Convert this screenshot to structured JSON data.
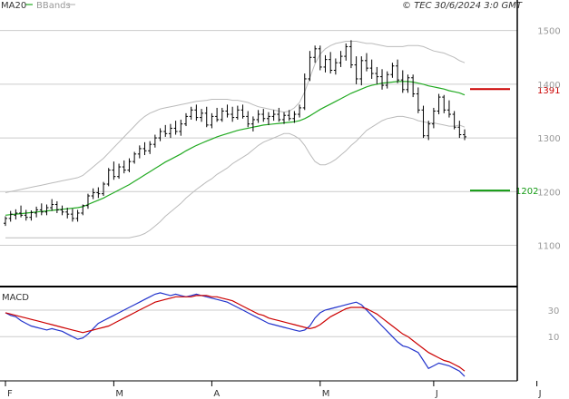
{
  "header": {
    "ma_label": "MA20",
    "bbands_label": "BBands",
    "copyright": "© TEC 30/6/2024 3:0 GMT"
  },
  "colors": {
    "ma": "#22aa22",
    "bbands": "#bbbbbb",
    "resistance": "#cc0000",
    "support": "#119911",
    "macd": "#2233cc",
    "signal": "#cc0000",
    "bars": "#000000",
    "grid": "#cccccc"
  },
  "chart_data": [
    {
      "type": "line",
      "name": "price",
      "ylim": [
        1040,
        1540
      ],
      "yticks": [
        1100,
        1200,
        1300,
        1400,
        1500
      ],
      "ytick_labels": [
        "1100",
        "1200",
        "1300",
        "1400",
        "1500"
      ],
      "month_labels": [
        {
          "label": "F",
          "index": 0
        },
        {
          "label": "M",
          "index": 21
        },
        {
          "label": "A",
          "index": 40
        },
        {
          "label": "M",
          "index": 61
        },
        {
          "label": "J",
          "index": 83
        },
        {
          "label": "J",
          "index": 103
        }
      ],
      "ohlc": [
        [
          1141,
          1154,
          1136,
          1150
        ],
        [
          1150,
          1164,
          1144,
          1158
        ],
        [
          1156,
          1167,
          1148,
          1160
        ],
        [
          1160,
          1174,
          1152,
          1156
        ],
        [
          1156,
          1166,
          1146,
          1152
        ],
        [
          1152,
          1165,
          1146,
          1161
        ],
        [
          1160,
          1172,
          1152,
          1166
        ],
        [
          1166,
          1178,
          1156,
          1162
        ],
        [
          1162,
          1176,
          1156,
          1170
        ],
        [
          1170,
          1186,
          1164,
          1176
        ],
        [
          1176,
          1182,
          1160,
          1166
        ],
        [
          1166,
          1174,
          1156,
          1162
        ],
        [
          1162,
          1170,
          1150,
          1158
        ],
        [
          1158,
          1168,
          1144,
          1150
        ],
        [
          1150,
          1166,
          1144,
          1160
        ],
        [
          1160,
          1176,
          1156,
          1174
        ],
        [
          1174,
          1196,
          1168,
          1192
        ],
        [
          1192,
          1206,
          1186,
          1198
        ],
        [
          1198,
          1208,
          1188,
          1196
        ],
        [
          1196,
          1218,
          1192,
          1214
        ],
        [
          1214,
          1244,
          1210,
          1240
        ],
        [
          1240,
          1256,
          1222,
          1228
        ],
        [
          1228,
          1252,
          1224,
          1246
        ],
        [
          1246,
          1258,
          1234,
          1240
        ],
        [
          1240,
          1262,
          1236,
          1256
        ],
        [
          1256,
          1274,
          1252,
          1270
        ],
        [
          1270,
          1286,
          1262,
          1280
        ],
        [
          1280,
          1292,
          1268,
          1276
        ],
        [
          1276,
          1294,
          1270,
          1288
        ],
        [
          1288,
          1306,
          1282,
          1300
        ],
        [
          1300,
          1318,
          1294,
          1312
        ],
        [
          1312,
          1324,
          1302,
          1308
        ],
        [
          1308,
          1326,
          1300,
          1318
        ],
        [
          1318,
          1332,
          1306,
          1312
        ],
        [
          1312,
          1334,
          1304,
          1326
        ],
        [
          1326,
          1346,
          1322,
          1340
        ],
        [
          1340,
          1358,
          1334,
          1352
        ],
        [
          1352,
          1362,
          1332,
          1338
        ],
        [
          1338,
          1354,
          1330,
          1346
        ],
        [
          1346,
          1358,
          1320,
          1324
        ],
        [
          1324,
          1346,
          1318,
          1340
        ],
        [
          1340,
          1356,
          1330,
          1334
        ],
        [
          1334,
          1356,
          1330,
          1350
        ],
        [
          1350,
          1362,
          1338,
          1344
        ],
        [
          1344,
          1358,
          1330,
          1338
        ],
        [
          1338,
          1360,
          1334,
          1352
        ],
        [
          1352,
          1362,
          1336,
          1340
        ],
        [
          1340,
          1350,
          1320,
          1326
        ],
        [
          1326,
          1340,
          1312,
          1334
        ],
        [
          1334,
          1352,
          1328,
          1344
        ],
        [
          1344,
          1354,
          1330,
          1336
        ],
        [
          1336,
          1348,
          1324,
          1340
        ],
        [
          1340,
          1352,
          1332,
          1344
        ],
        [
          1344,
          1356,
          1330,
          1334
        ],
        [
          1334,
          1348,
          1326,
          1342
        ],
        [
          1342,
          1352,
          1332,
          1336
        ],
        [
          1336,
          1350,
          1328,
          1344
        ],
        [
          1344,
          1362,
          1338,
          1356
        ],
        [
          1356,
          1420,
          1352,
          1410
        ],
        [
          1410,
          1462,
          1406,
          1450
        ],
        [
          1450,
          1472,
          1440,
          1466
        ],
        [
          1466,
          1472,
          1426,
          1432
        ],
        [
          1432,
          1454,
          1422,
          1446
        ],
        [
          1446,
          1460,
          1420,
          1426
        ],
        [
          1426,
          1448,
          1418,
          1440
        ],
        [
          1440,
          1462,
          1432,
          1452
        ],
        [
          1452,
          1476,
          1444,
          1470
        ],
        [
          1470,
          1482,
          1430,
          1436
        ],
        [
          1436,
          1452,
          1400,
          1410
        ],
        [
          1410,
          1452,
          1398,
          1444
        ],
        [
          1444,
          1458,
          1424,
          1430
        ],
        [
          1430,
          1446,
          1410,
          1420
        ],
        [
          1420,
          1432,
          1400,
          1414
        ],
        [
          1414,
          1428,
          1390,
          1398
        ],
        [
          1398,
          1424,
          1392,
          1418
        ],
        [
          1418,
          1440,
          1412,
          1434
        ],
        [
          1434,
          1446,
          1402,
          1408
        ],
        [
          1408,
          1426,
          1384,
          1390
        ],
        [
          1390,
          1418,
          1384,
          1412
        ],
        [
          1412,
          1418,
          1376,
          1382
        ],
        [
          1382,
          1394,
          1346,
          1352
        ],
        [
          1352,
          1360,
          1300,
          1304
        ],
        [
          1304,
          1332,
          1296,
          1326
        ],
        [
          1326,
          1356,
          1318,
          1350
        ],
        [
          1350,
          1382,
          1344,
          1376
        ],
        [
          1376,
          1380,
          1346,
          1352
        ],
        [
          1352,
          1370,
          1338,
          1344
        ],
        [
          1344,
          1350,
          1316,
          1320
        ],
        [
          1320,
          1332,
          1300,
          1306
        ],
        [
          1306,
          1316,
          1296,
          1302
        ]
      ],
      "ma20": [
        1156,
        1157,
        1158,
        1159,
        1160,
        1161,
        1162,
        1163,
        1164,
        1165,
        1166,
        1167,
        1168,
        1169,
        1170,
        1172,
        1176,
        1180,
        1184,
        1188,
        1193,
        1198,
        1203,
        1208,
        1213,
        1219,
        1225,
        1231,
        1237,
        1243,
        1249,
        1255,
        1260,
        1265,
        1270,
        1276,
        1281,
        1286,
        1290,
        1294,
        1298,
        1302,
        1305,
        1308,
        1311,
        1314,
        1316,
        1318,
        1320,
        1322,
        1324,
        1325,
        1326,
        1327,
        1328,
        1329,
        1330,
        1332,
        1336,
        1341,
        1347,
        1353,
        1358,
        1363,
        1368,
        1373,
        1378,
        1383,
        1387,
        1391,
        1395,
        1398,
        1400,
        1402,
        1403,
        1404,
        1405,
        1405,
        1405,
        1404,
        1402,
        1400,
        1397,
        1395,
        1393,
        1391,
        1388,
        1386,
        1384,
        1380
      ],
      "bb_upper": [
        1198,
        1200,
        1202,
        1204,
        1206,
        1208,
        1210,
        1212,
        1214,
        1216,
        1218,
        1220,
        1222,
        1224,
        1226,
        1230,
        1238,
        1246,
        1254,
        1262,
        1272,
        1282,
        1292,
        1302,
        1312,
        1322,
        1332,
        1340,
        1346,
        1350,
        1354,
        1356,
        1358,
        1360,
        1362,
        1364,
        1366,
        1368,
        1369,
        1370,
        1372,
        1372,
        1372,
        1372,
        1370,
        1370,
        1368,
        1366,
        1362,
        1358,
        1356,
        1354,
        1352,
        1350,
        1348,
        1350,
        1356,
        1366,
        1386,
        1412,
        1438,
        1456,
        1466,
        1472,
        1476,
        1478,
        1480,
        1480,
        1480,
        1478,
        1476,
        1476,
        1474,
        1472,
        1470,
        1470,
        1470,
        1470,
        1472,
        1472,
        1472,
        1470,
        1466,
        1462,
        1460,
        1458,
        1454,
        1450,
        1444,
        1440
      ],
      "bb_lower": [
        1114,
        1114,
        1114,
        1114,
        1114,
        1114,
        1114,
        1114,
        1114,
        1114,
        1114,
        1114,
        1114,
        1114,
        1114,
        1114,
        1114,
        1114,
        1114,
        1114,
        1114,
        1114,
        1114,
        1114,
        1114,
        1116,
        1118,
        1122,
        1128,
        1136,
        1144,
        1154,
        1162,
        1170,
        1178,
        1188,
        1196,
        1204,
        1211,
        1218,
        1224,
        1232,
        1238,
        1244,
        1252,
        1258,
        1264,
        1270,
        1278,
        1286,
        1292,
        1296,
        1300,
        1304,
        1308,
        1308,
        1304,
        1298,
        1286,
        1270,
        1256,
        1250,
        1250,
        1254,
        1260,
        1268,
        1276,
        1286,
        1294,
        1304,
        1314,
        1320,
        1326,
        1332,
        1336,
        1338,
        1340,
        1340,
        1338,
        1336,
        1332,
        1330,
        1328,
        1328,
        1326,
        1324,
        1322,
        1322,
        1324,
        1320
      ],
      "resistance": {
        "value": 1391,
        "label": "1391"
      },
      "support": {
        "value": 1202,
        "label": "1202"
      },
      "series": [
        {
          "name": "MA20"
        },
        {
          "name": "BBands"
        }
      ]
    },
    {
      "type": "line",
      "title": "MACD",
      "ylim": [
        -22,
        45
      ],
      "yticks": [
        30,
        10
      ],
      "ytick_labels": [
        "30",
        "10"
      ],
      "macd": [
        28,
        26,
        25,
        22,
        20,
        18,
        17,
        16,
        15,
        16,
        15,
        14,
        12,
        10,
        8,
        9,
        12,
        16,
        20,
        22,
        24,
        26,
        28,
        30,
        32,
        34,
        36,
        38,
        40,
        42,
        43,
        42,
        41,
        42,
        41,
        40,
        41,
        42,
        41,
        40,
        39,
        38,
        37,
        36,
        34,
        32,
        30,
        28,
        26,
        24,
        22,
        20,
        19,
        18,
        17,
        16,
        15,
        14,
        15,
        18,
        24,
        28,
        30,
        31,
        32,
        33,
        34,
        35,
        36,
        34,
        30,
        26,
        22,
        18,
        14,
        10,
        6,
        3,
        2,
        0,
        -2,
        -8,
        -14,
        -12,
        -10,
        -11,
        -12,
        -14,
        -16,
        -20
      ],
      "signal": [
        28,
        27,
        26,
        25,
        24,
        23,
        22,
        21,
        20,
        19,
        18,
        17,
        16,
        15,
        14,
        13,
        14,
        15,
        16,
        17,
        18,
        20,
        22,
        24,
        26,
        28,
        30,
        32,
        34,
        36,
        37,
        38,
        39,
        40,
        40,
        40,
        40,
        41,
        41,
        41,
        40,
        40,
        39,
        38,
        37,
        35,
        33,
        31,
        29,
        27,
        26,
        24,
        23,
        22,
        21,
        20,
        19,
        18,
        17,
        16,
        17,
        19,
        22,
        25,
        27,
        29,
        31,
        32,
        32,
        32,
        31,
        29,
        27,
        24,
        21,
        18,
        15,
        12,
        10,
        7,
        4,
        1,
        -2,
        -4,
        -6,
        -8,
        -9,
        -11,
        -13,
        -16
      ]
    }
  ]
}
